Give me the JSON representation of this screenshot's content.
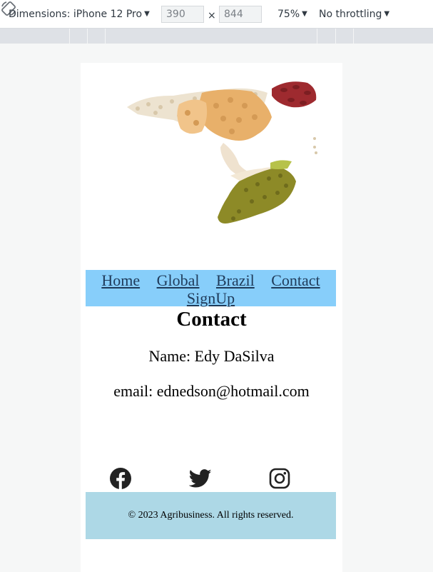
{
  "devtools": {
    "device_label": "Dimensions: iPhone 12 Pro",
    "width_value": "390",
    "height_value": "844",
    "times_sign": "×",
    "zoom": "75%",
    "throttle": "No throttling"
  },
  "nav": {
    "items": [
      "Home",
      "Global",
      "Brazil",
      "Contact",
      "SignUp"
    ]
  },
  "page": {
    "title": "Contact",
    "name_line": "Name: Edy DaSilva",
    "email_line": "email: ednedson@hotmail.com"
  },
  "social": {
    "icons": [
      "facebook-icon",
      "twitter-icon",
      "instagram-icon"
    ]
  },
  "footer": {
    "text": "© 2023 Agribusiness. All rights reserved."
  },
  "colors": {
    "nav_bg": "#87cefa",
    "footer_bg": "#add8e6",
    "link": "#1f3b5a"
  }
}
